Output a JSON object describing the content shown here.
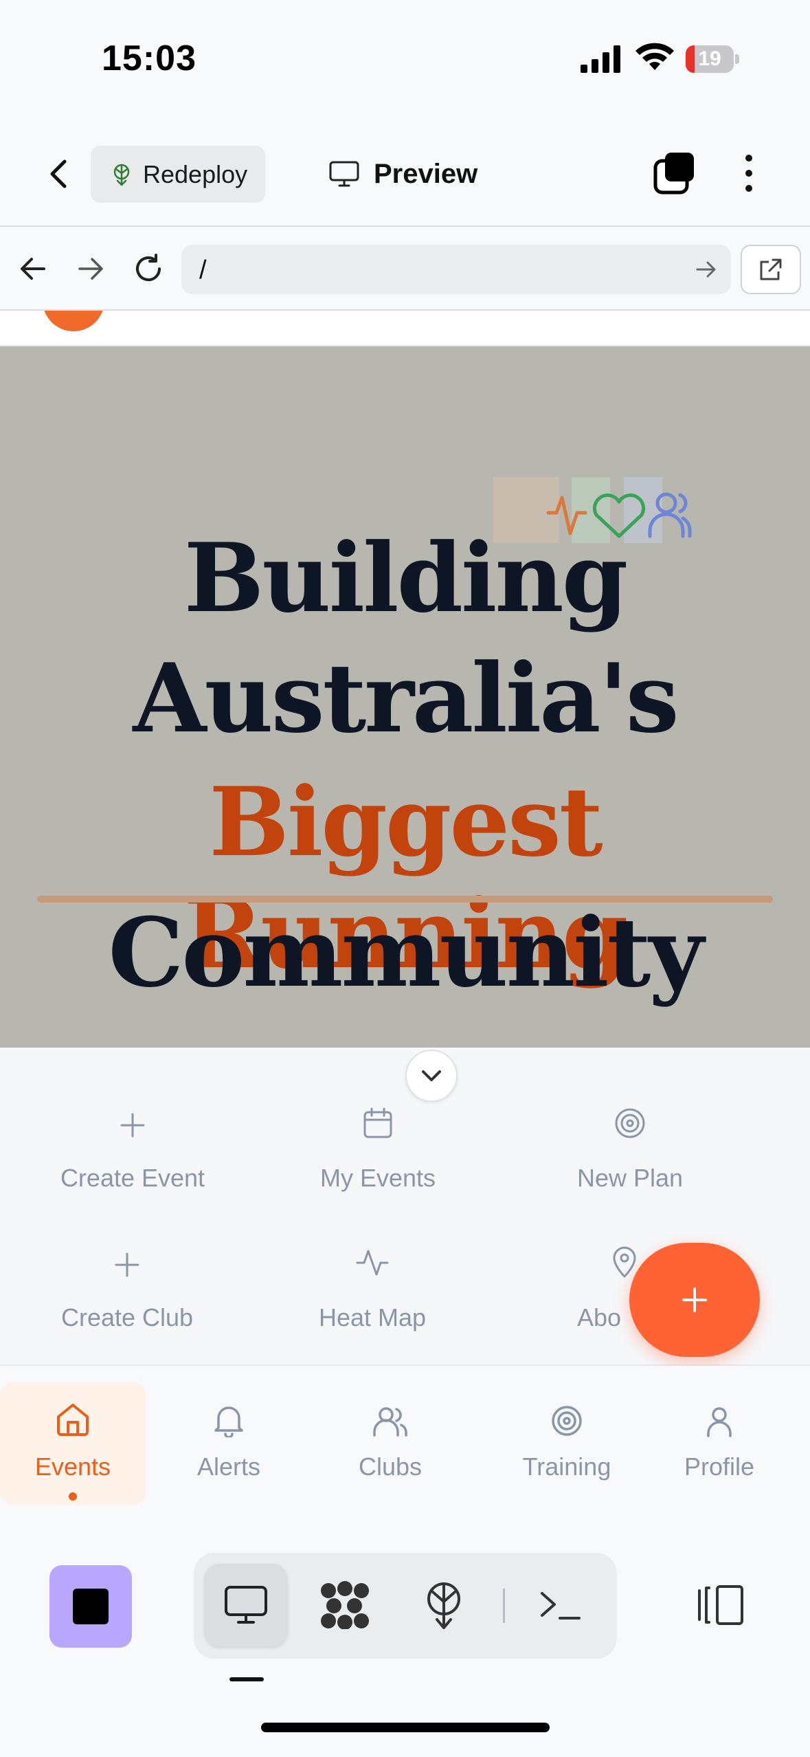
{
  "status_bar": {
    "time": "15:03",
    "battery": "19",
    "battery_level": 0.19
  },
  "header": {
    "redeploy_label": "Redeploy",
    "preview_label": "Preview"
  },
  "browser": {
    "url": "/"
  },
  "hero": {
    "line1": "Building",
    "line2": "Australia's",
    "line3": "Biggest Running",
    "line4": "Community",
    "accent_color": "#c2440c"
  },
  "quick_actions": [
    {
      "label": "Create Event",
      "icon": "plus-icon"
    },
    {
      "label": "My Events",
      "icon": "calendar-icon"
    },
    {
      "label": "New Plan",
      "icon": "target-icon"
    },
    {
      "label": "Create Club",
      "icon": "plus-icon"
    },
    {
      "label": "Heat Map",
      "icon": "activity-icon"
    },
    {
      "label": "Abo",
      "icon": "map-pin-icon"
    }
  ],
  "tabs": [
    {
      "label": "Events",
      "icon": "home-icon",
      "active": true
    },
    {
      "label": "Alerts",
      "icon": "bell-icon"
    },
    {
      "label": "Clubs",
      "icon": "users-icon"
    },
    {
      "label": "Training",
      "icon": "target-icon"
    },
    {
      "label": "Profile",
      "icon": "user-icon"
    }
  ],
  "colors": {
    "brand_orange": "#ff6333",
    "active_tab": "#e8611c",
    "muted": "#8a96a8",
    "stop_button": "#b9a6ff"
  }
}
